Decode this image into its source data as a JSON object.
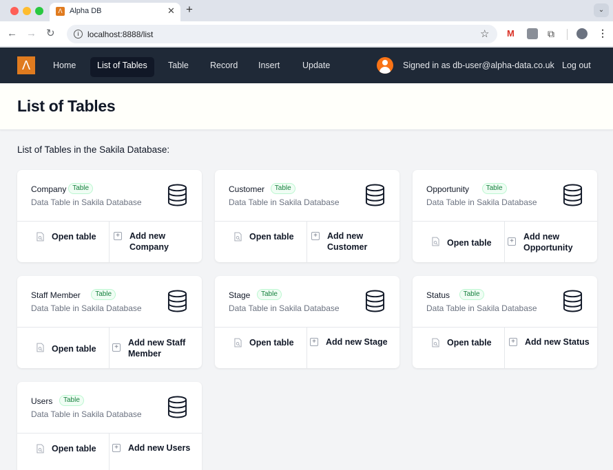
{
  "browser": {
    "tab_title": "Alpha DB",
    "url": "localhost:8888/list"
  },
  "nav": {
    "links": [
      "Home",
      "List of Tables",
      "Table",
      "Record",
      "Insert",
      "Update"
    ],
    "active": "List of Tables",
    "signed_in": "Signed in as db-user@alpha-data.co.uk",
    "logout": "Log out"
  },
  "page": {
    "title": "List of Tables",
    "intro": "List of Tables in the Sakila Database:"
  },
  "colors": {
    "nav_bg": "#1f2937",
    "accent": "#e07b1f",
    "badge_green": "#15803d"
  },
  "cards": [
    {
      "name": "Company",
      "badge": "Table",
      "subtitle": "Data Table in Sakila Database",
      "open_label": "Open table",
      "add_line1": "Add new Company",
      "add_line2": ""
    },
    {
      "name": "Customer",
      "badge": "Table",
      "subtitle": "Data Table in Sakila Database",
      "open_label": "Open table",
      "add_line1": "Add new Customer",
      "add_line2": ""
    },
    {
      "name": "Opportunity",
      "badge": "Table",
      "subtitle": "Data Table in Sakila Database",
      "open_label": "Open table",
      "add_line1": "Add new",
      "add_line2": "Opportunity"
    },
    {
      "name": "Staff Member",
      "badge": "Table",
      "subtitle": "Data Table in Sakila Database",
      "open_label": "Open table",
      "add_line1": "Add new Staff",
      "add_line2": "Member"
    },
    {
      "name": "Stage",
      "badge": "Table",
      "subtitle": "Data Table in Sakila Database",
      "open_label": "Open table",
      "add_line1": "Add new Stage",
      "add_line2": ""
    },
    {
      "name": "Status",
      "badge": "Table",
      "subtitle": "Data Table in Sakila Database",
      "open_label": "Open table",
      "add_line1": "Add new Status",
      "add_line2": ""
    },
    {
      "name": "Users",
      "badge": "Table",
      "subtitle": "Data Table in Sakila Database",
      "open_label": "Open table",
      "add_line1": "Add new Users",
      "add_line2": ""
    }
  ]
}
